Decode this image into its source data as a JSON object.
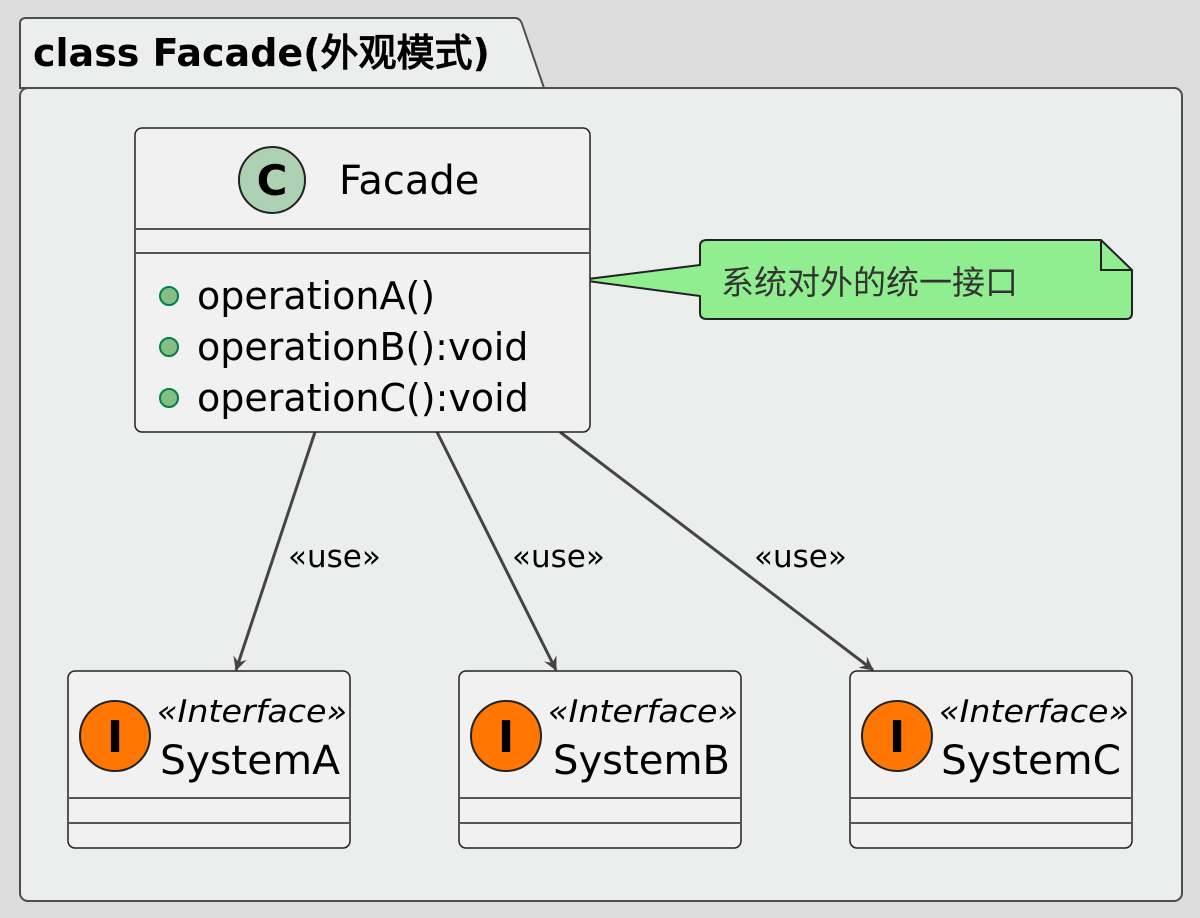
{
  "package": {
    "title": "class Facade(外观模式)"
  },
  "facade": {
    "name": "Facade",
    "circle_letter": "C",
    "methods": [
      {
        "label": "operationA()"
      },
      {
        "label": "operationB():void"
      },
      {
        "label": "operationC():void"
      }
    ]
  },
  "note": {
    "text": "系统对外的统一接口"
  },
  "interfaces": [
    {
      "circle_letter": "I",
      "stereotype": "«Interface»",
      "name": "SystemA"
    },
    {
      "circle_letter": "I",
      "stereotype": "«Interface»",
      "name": "SystemB"
    },
    {
      "circle_letter": "I",
      "stereotype": "«Interface»",
      "name": "SystemC"
    }
  ],
  "relations": [
    {
      "label": "«use»"
    },
    {
      "label": "«use»"
    },
    {
      "label": "«use»"
    }
  ],
  "colors": {
    "background": "#dddddd",
    "package_fill": "#eceeed",
    "package_stroke": "#4d4d4d",
    "class_fill": "#f1f1f1",
    "class_circle": "#add1b2",
    "interface_circle": "#ff7700",
    "method_dot": "#84be84",
    "method_dot_stroke": "#038048",
    "note_fill": "#90ee90",
    "line": "#454545"
  }
}
